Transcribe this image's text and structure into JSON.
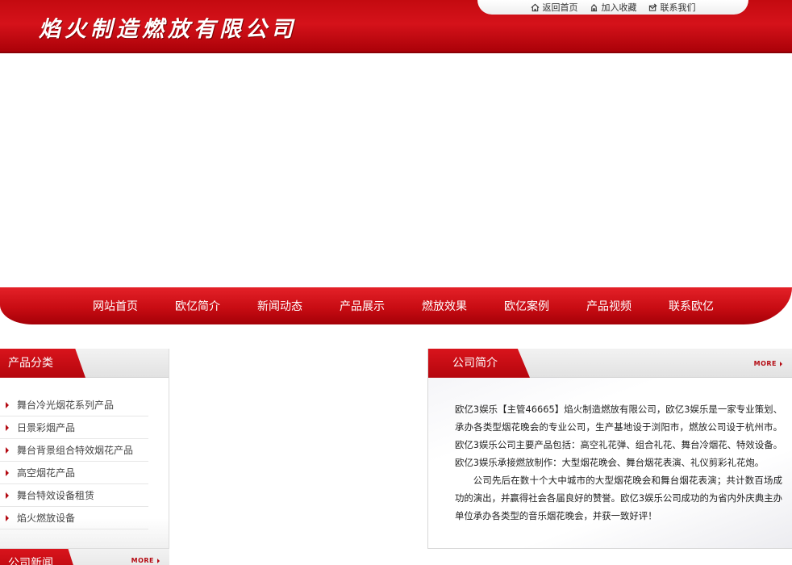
{
  "header": {
    "logo_text": "焰火制造燃放有限公司",
    "top_links": [
      {
        "label": "返回首页",
        "icon": "home-icon"
      },
      {
        "label": "加入收藏",
        "icon": "bookmark-icon"
      },
      {
        "label": "联系我们",
        "icon": "contact-icon"
      }
    ]
  },
  "nav": {
    "items": [
      "网站首页",
      "欧亿简介",
      "新闻动态",
      "产品展示",
      "燃放效果",
      "欧亿案例",
      "产品视频",
      "联系欧亿"
    ]
  },
  "categories": {
    "title": "产品分类",
    "items": [
      "舞台冷光烟花系列产品",
      "日景彩烟产品",
      "舞台背景组合特效烟花产品",
      "高空烟花产品",
      "舞台特效设备租赁",
      "焰火燃放设备"
    ]
  },
  "news": {
    "title": "公司新闻",
    "more_label": "MORE"
  },
  "intro": {
    "title": "公司简介",
    "more_label": "MORE",
    "paragraph1": "欧亿3娱乐【主管46665】焰火制造燃放有限公司，欧亿3娱乐是一家专业策划、承办各类型烟花晚会的专业公司，生产基地设于浏阳市，燃放公司设于杭州市。欧亿3娱乐公司主要产品包括：高空礼花弹、组合礼花、舞台冷烟花、特效设备。欧亿3娱乐承接燃放制作：大型烟花晚会、舞台烟花表演、礼仪剪彩礼花炮。",
    "paragraph2": "公司先后在数十个大中城市的大型烟花晚会和舞台烟花表演；共计数百场成功的演出，并赢得社会各届良好的赞誉。欧亿3娱乐公司成功的为省内外庆典主办单位承办各类型的音乐烟花晚会，并获一致好评！"
  },
  "colors": {
    "brand_red": "#c80c13",
    "dark_red": "#a40007"
  }
}
